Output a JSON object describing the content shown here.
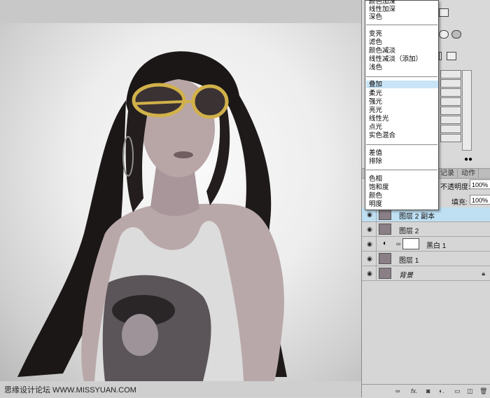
{
  "blend_menu": {
    "items": [
      {
        "label": "颜色加深",
        "group": 1
      },
      {
        "label": "线性加深",
        "group": 1
      },
      {
        "label": "深色",
        "group": 1
      },
      {
        "label": "变亮",
        "group": 2
      },
      {
        "label": "滤色",
        "group": 2
      },
      {
        "label": "颜色减淡",
        "group": 2
      },
      {
        "label": "线性减淡（添加）",
        "group": 2
      },
      {
        "label": "浅色",
        "group": 2
      },
      {
        "label": "叠加",
        "group": 3,
        "highlighted": true
      },
      {
        "label": "柔光",
        "group": 3
      },
      {
        "label": "强光",
        "group": 3
      },
      {
        "label": "亮光",
        "group": 3
      },
      {
        "label": "线性光",
        "group": 3
      },
      {
        "label": "点光",
        "group": 3
      },
      {
        "label": "实色混合",
        "group": 3
      },
      {
        "label": "差值",
        "group": 4
      },
      {
        "label": "排除",
        "group": 4
      },
      {
        "label": "色相",
        "group": 5
      },
      {
        "label": "饱和度",
        "group": 5
      },
      {
        "label": "颜色",
        "group": 5
      },
      {
        "label": "明度",
        "group": 5
      }
    ]
  },
  "panel": {
    "tabs": [
      "记录",
      "动作"
    ],
    "opacity_label": "不透明度:",
    "opacity_value": "100%",
    "fill_label": "填充:",
    "fill_value": "100%"
  },
  "layers": [
    {
      "name": "图层 2 副本",
      "selected": true,
      "type": "pixel"
    },
    {
      "name": "图层 2",
      "selected": false,
      "type": "pixel"
    },
    {
      "name": "黑白 1",
      "selected": false,
      "type": "adjustment"
    },
    {
      "name": "图层 1",
      "selected": false,
      "type": "pixel"
    },
    {
      "name": "背景",
      "selected": false,
      "type": "background",
      "locked": true
    }
  ],
  "watermark": "思缘设计论坛 WWW.MISSYUAN.COM",
  "colors": {
    "selection": "#c9e4f6",
    "layer_selected": "#bfe0f3",
    "panel": "#d6d6d6",
    "photo_bg": "#ededed"
  },
  "icons": [
    "eye-icon",
    "link-icon",
    "fx-icon",
    "mask-icon",
    "adjustment-icon",
    "folder-icon",
    "new-layer-icon",
    "trash-icon",
    "lock-icon"
  ]
}
